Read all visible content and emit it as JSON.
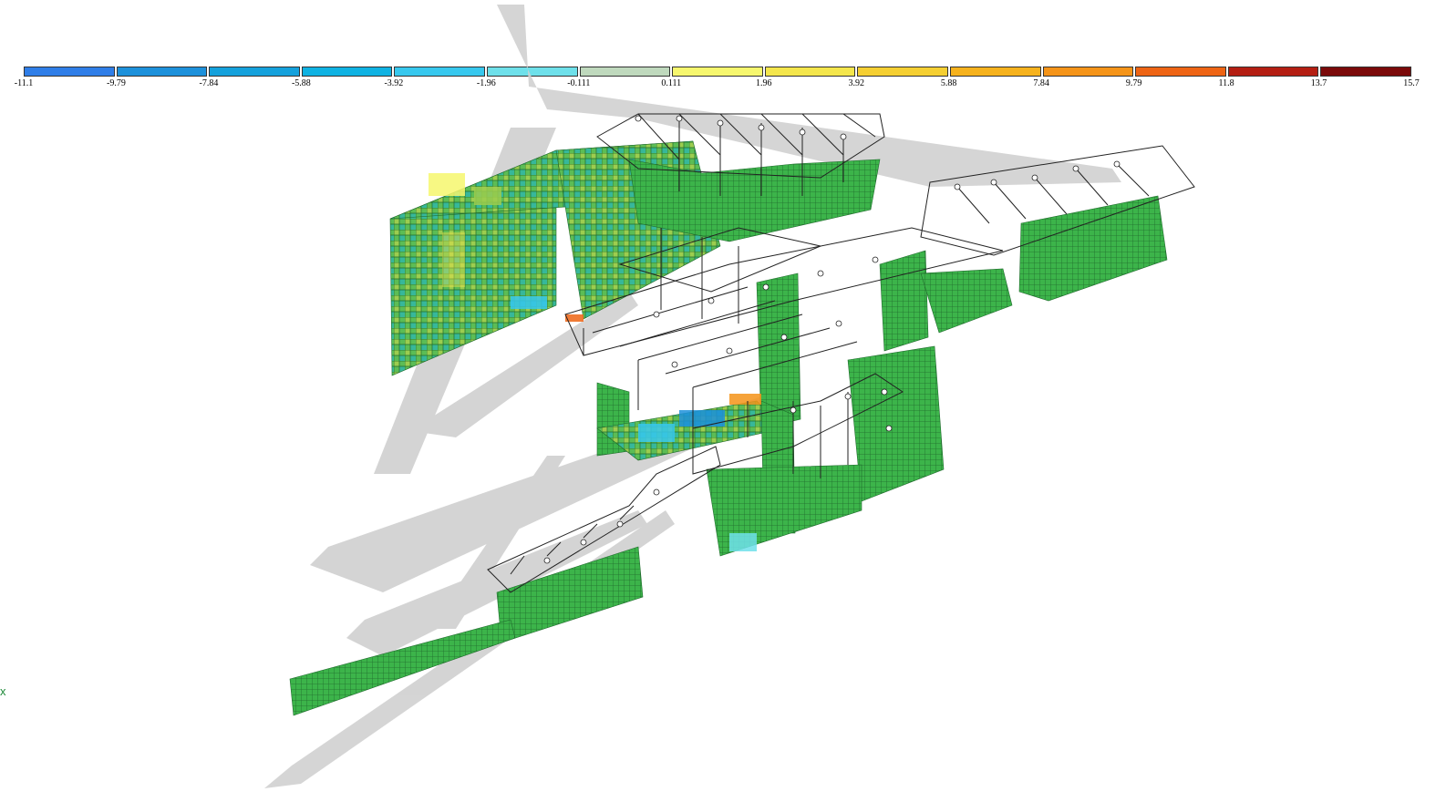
{
  "legend": {
    "colors": [
      "#2f7ee8",
      "#1d91db",
      "#14a1dc",
      "#0fb2e2",
      "#37c8ee",
      "#6ee0ea",
      "#bfd9bd",
      "#f6f76e",
      "#f4e64c",
      "#f5cf32",
      "#f6b21d",
      "#f59418",
      "#ee6414",
      "#b41e12",
      "#7b0a0a"
    ],
    "ticks": [
      "-11.1",
      "-9.79",
      "-7.84",
      "-5.88",
      "-3.92",
      "-1.96",
      "-0.111",
      "0.111",
      "1.96",
      "3.92",
      "5.88",
      "7.84",
      "9.79",
      "11.8",
      "13.7",
      "15.7"
    ]
  },
  "model": {
    "mesh_color": "#36b44a",
    "mesh_line_color": "#1f6b2c",
    "frame_color": "#222222",
    "watermark_color": "#d0d0d0"
  },
  "axis": {
    "label": "x"
  }
}
